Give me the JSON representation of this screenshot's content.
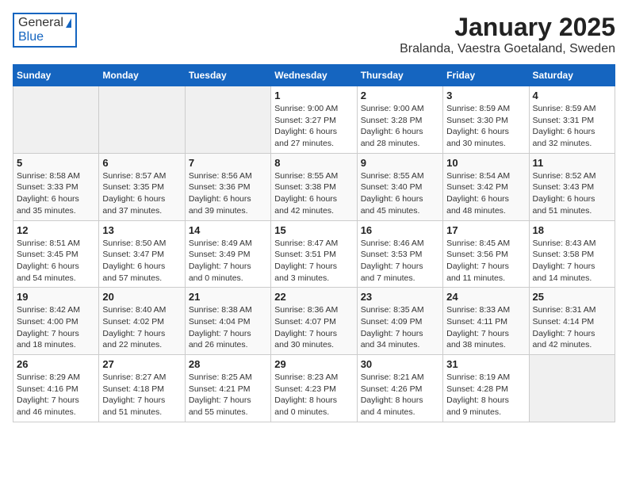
{
  "header": {
    "logo_general": "General",
    "logo_blue": "Blue",
    "month_title": "January 2025",
    "location": "Bralanda, Vaestra Goetaland, Sweden"
  },
  "days_of_week": [
    "Sunday",
    "Monday",
    "Tuesday",
    "Wednesday",
    "Thursday",
    "Friday",
    "Saturday"
  ],
  "weeks": [
    [
      {
        "day": "",
        "content": ""
      },
      {
        "day": "",
        "content": ""
      },
      {
        "day": "",
        "content": ""
      },
      {
        "day": "1",
        "content": "Sunrise: 9:00 AM\nSunset: 3:27 PM\nDaylight: 6 hours\nand 27 minutes."
      },
      {
        "day": "2",
        "content": "Sunrise: 9:00 AM\nSunset: 3:28 PM\nDaylight: 6 hours\nand 28 minutes."
      },
      {
        "day": "3",
        "content": "Sunrise: 8:59 AM\nSunset: 3:30 PM\nDaylight: 6 hours\nand 30 minutes."
      },
      {
        "day": "4",
        "content": "Sunrise: 8:59 AM\nSunset: 3:31 PM\nDaylight: 6 hours\nand 32 minutes."
      }
    ],
    [
      {
        "day": "5",
        "content": "Sunrise: 8:58 AM\nSunset: 3:33 PM\nDaylight: 6 hours\nand 35 minutes."
      },
      {
        "day": "6",
        "content": "Sunrise: 8:57 AM\nSunset: 3:35 PM\nDaylight: 6 hours\nand 37 minutes."
      },
      {
        "day": "7",
        "content": "Sunrise: 8:56 AM\nSunset: 3:36 PM\nDaylight: 6 hours\nand 39 minutes."
      },
      {
        "day": "8",
        "content": "Sunrise: 8:55 AM\nSunset: 3:38 PM\nDaylight: 6 hours\nand 42 minutes."
      },
      {
        "day": "9",
        "content": "Sunrise: 8:55 AM\nSunset: 3:40 PM\nDaylight: 6 hours\nand 45 minutes."
      },
      {
        "day": "10",
        "content": "Sunrise: 8:54 AM\nSunset: 3:42 PM\nDaylight: 6 hours\nand 48 minutes."
      },
      {
        "day": "11",
        "content": "Sunrise: 8:52 AM\nSunset: 3:43 PM\nDaylight: 6 hours\nand 51 minutes."
      }
    ],
    [
      {
        "day": "12",
        "content": "Sunrise: 8:51 AM\nSunset: 3:45 PM\nDaylight: 6 hours\nand 54 minutes."
      },
      {
        "day": "13",
        "content": "Sunrise: 8:50 AM\nSunset: 3:47 PM\nDaylight: 6 hours\nand 57 minutes."
      },
      {
        "day": "14",
        "content": "Sunrise: 8:49 AM\nSunset: 3:49 PM\nDaylight: 7 hours\nand 0 minutes."
      },
      {
        "day": "15",
        "content": "Sunrise: 8:47 AM\nSunset: 3:51 PM\nDaylight: 7 hours\nand 3 minutes."
      },
      {
        "day": "16",
        "content": "Sunrise: 8:46 AM\nSunset: 3:53 PM\nDaylight: 7 hours\nand 7 minutes."
      },
      {
        "day": "17",
        "content": "Sunrise: 8:45 AM\nSunset: 3:56 PM\nDaylight: 7 hours\nand 11 minutes."
      },
      {
        "day": "18",
        "content": "Sunrise: 8:43 AM\nSunset: 3:58 PM\nDaylight: 7 hours\nand 14 minutes."
      }
    ],
    [
      {
        "day": "19",
        "content": "Sunrise: 8:42 AM\nSunset: 4:00 PM\nDaylight: 7 hours\nand 18 minutes."
      },
      {
        "day": "20",
        "content": "Sunrise: 8:40 AM\nSunset: 4:02 PM\nDaylight: 7 hours\nand 22 minutes."
      },
      {
        "day": "21",
        "content": "Sunrise: 8:38 AM\nSunset: 4:04 PM\nDaylight: 7 hours\nand 26 minutes."
      },
      {
        "day": "22",
        "content": "Sunrise: 8:36 AM\nSunset: 4:07 PM\nDaylight: 7 hours\nand 30 minutes."
      },
      {
        "day": "23",
        "content": "Sunrise: 8:35 AM\nSunset: 4:09 PM\nDaylight: 7 hours\nand 34 minutes."
      },
      {
        "day": "24",
        "content": "Sunrise: 8:33 AM\nSunset: 4:11 PM\nDaylight: 7 hours\nand 38 minutes."
      },
      {
        "day": "25",
        "content": "Sunrise: 8:31 AM\nSunset: 4:14 PM\nDaylight: 7 hours\nand 42 minutes."
      }
    ],
    [
      {
        "day": "26",
        "content": "Sunrise: 8:29 AM\nSunset: 4:16 PM\nDaylight: 7 hours\nand 46 minutes."
      },
      {
        "day": "27",
        "content": "Sunrise: 8:27 AM\nSunset: 4:18 PM\nDaylight: 7 hours\nand 51 minutes."
      },
      {
        "day": "28",
        "content": "Sunrise: 8:25 AM\nSunset: 4:21 PM\nDaylight: 7 hours\nand 55 minutes."
      },
      {
        "day": "29",
        "content": "Sunrise: 8:23 AM\nSunset: 4:23 PM\nDaylight: 8 hours\nand 0 minutes."
      },
      {
        "day": "30",
        "content": "Sunrise: 8:21 AM\nSunset: 4:26 PM\nDaylight: 8 hours\nand 4 minutes."
      },
      {
        "day": "31",
        "content": "Sunrise: 8:19 AM\nSunset: 4:28 PM\nDaylight: 8 hours\nand 9 minutes."
      },
      {
        "day": "",
        "content": ""
      }
    ]
  ]
}
